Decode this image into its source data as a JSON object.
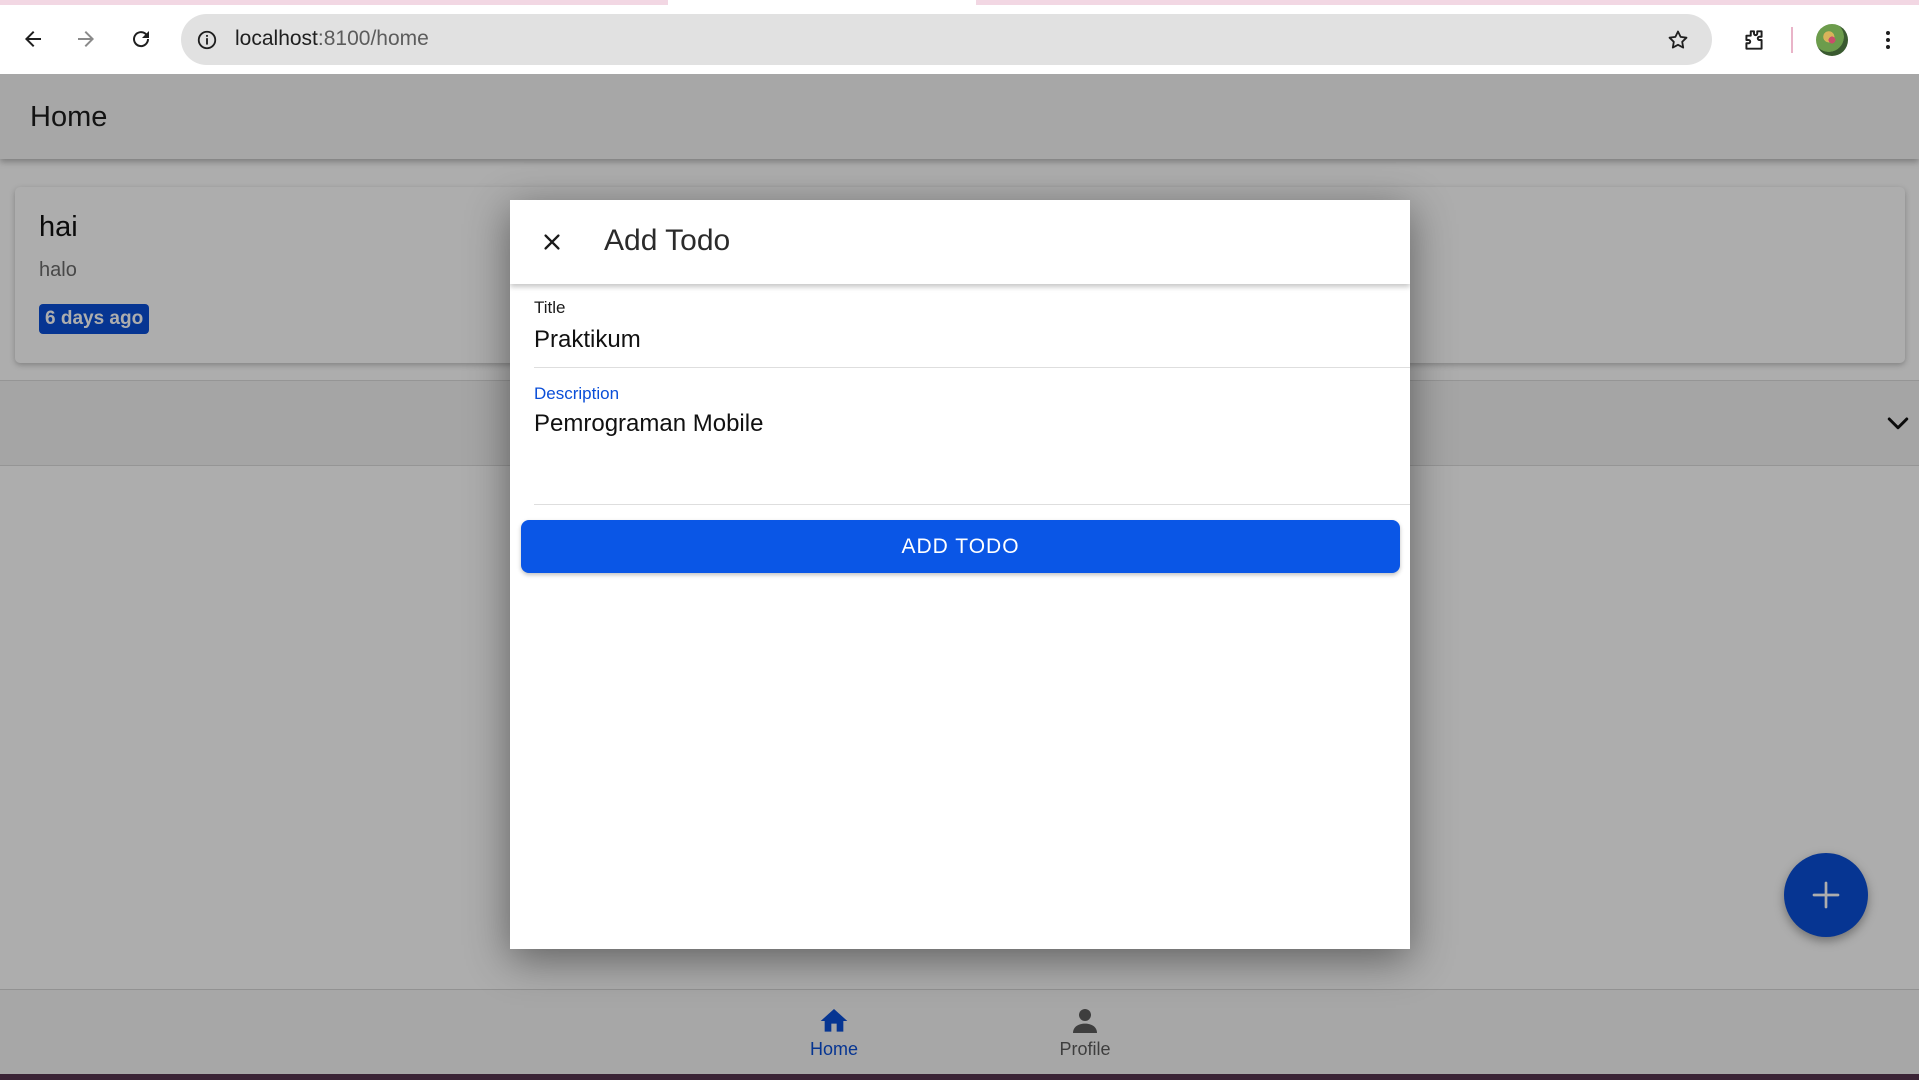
{
  "browser": {
    "url_host": "localhost",
    "url_path": ":8100/home",
    "icons": [
      "back-icon",
      "forward-icon",
      "reload-icon",
      "info-icon",
      "bookmark-star-icon",
      "extensions-icon",
      "profile-avatar",
      "more-menu-icon"
    ]
  },
  "header": {
    "title": "Home"
  },
  "todo": {
    "title": "hai",
    "description": "halo",
    "time_badge": "6 days ago"
  },
  "modal": {
    "title": "Add Todo",
    "title_field_label": "Title",
    "title_field_value": "Praktikum",
    "description_field_label": "Description",
    "description_field_value": "Pemrograman Mobile",
    "submit_label": "ADD TODO"
  },
  "tabs": [
    {
      "label": "Home",
      "icon": "home-icon",
      "active": true
    },
    {
      "label": "Profile",
      "icon": "person-icon",
      "active": false
    }
  ],
  "colors": {
    "primary": "#0a4ed8",
    "button": "#0a56e6",
    "backdrop": "rgba(0,0,0,0.32)"
  }
}
